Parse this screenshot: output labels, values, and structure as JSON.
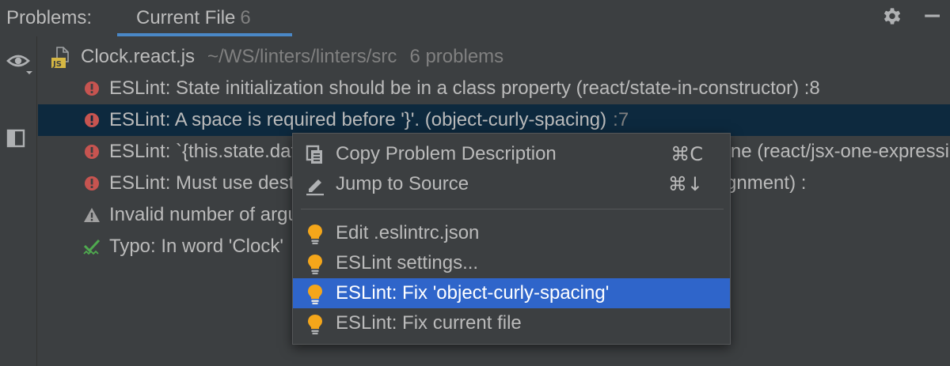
{
  "header": {
    "title": "Problems:",
    "tab_label": "Current File",
    "tab_count": "6"
  },
  "file": {
    "name": "Clock.react.js",
    "path": "~/WS/linters/linters/src",
    "count": "6 problems"
  },
  "problems": [
    {
      "icon": "error-icon",
      "text": "ESLint: State initialization should be in a class property (react/state-in-constructor) :8",
      "loc": ""
    },
    {
      "icon": "error-icon",
      "text": "ESLint: A space is required before '}'. (object-curly-spacing)",
      "loc": ":7"
    },
    {
      "icon": "error-icon",
      "text": "ESLint: `{this.state.date.toLocaleTimeString()}` must be placed on a new line (react/jsx-one-expression-per-line)",
      "loc": ""
    },
    {
      "icon": "error-icon",
      "text": "ESLint: Must use destructuring state assignment (react/destructuring-assignment) :",
      "loc": ""
    },
    {
      "icon": "warning-icon",
      "text": "Invalid number of arguments, expected 0",
      "loc": ""
    },
    {
      "icon": "typo-icon",
      "text": "Typo: In word 'Clock'",
      "loc": ""
    }
  ],
  "menu": {
    "copy_label": "Copy Problem Description",
    "copy_shortcut": "⌘C",
    "jump_label": "Jump to Source",
    "jump_shortcut": "⌘↓",
    "edit_label": "Edit .eslintrc.json",
    "settings_label": "ESLint settings...",
    "fix_label": "ESLint: Fix 'object-curly-spacing'",
    "fix_file_label": "ESLint: Fix current file"
  },
  "colors": {
    "background": "#3c3f41",
    "selected_row": "#0d293e",
    "selected_menu": "#2f65ca",
    "error": "#c75450",
    "warning": "#a0a0a0",
    "typo": "#4faa4f",
    "bulb": "#f4a61a",
    "tab_underline": "#4a88c7"
  }
}
